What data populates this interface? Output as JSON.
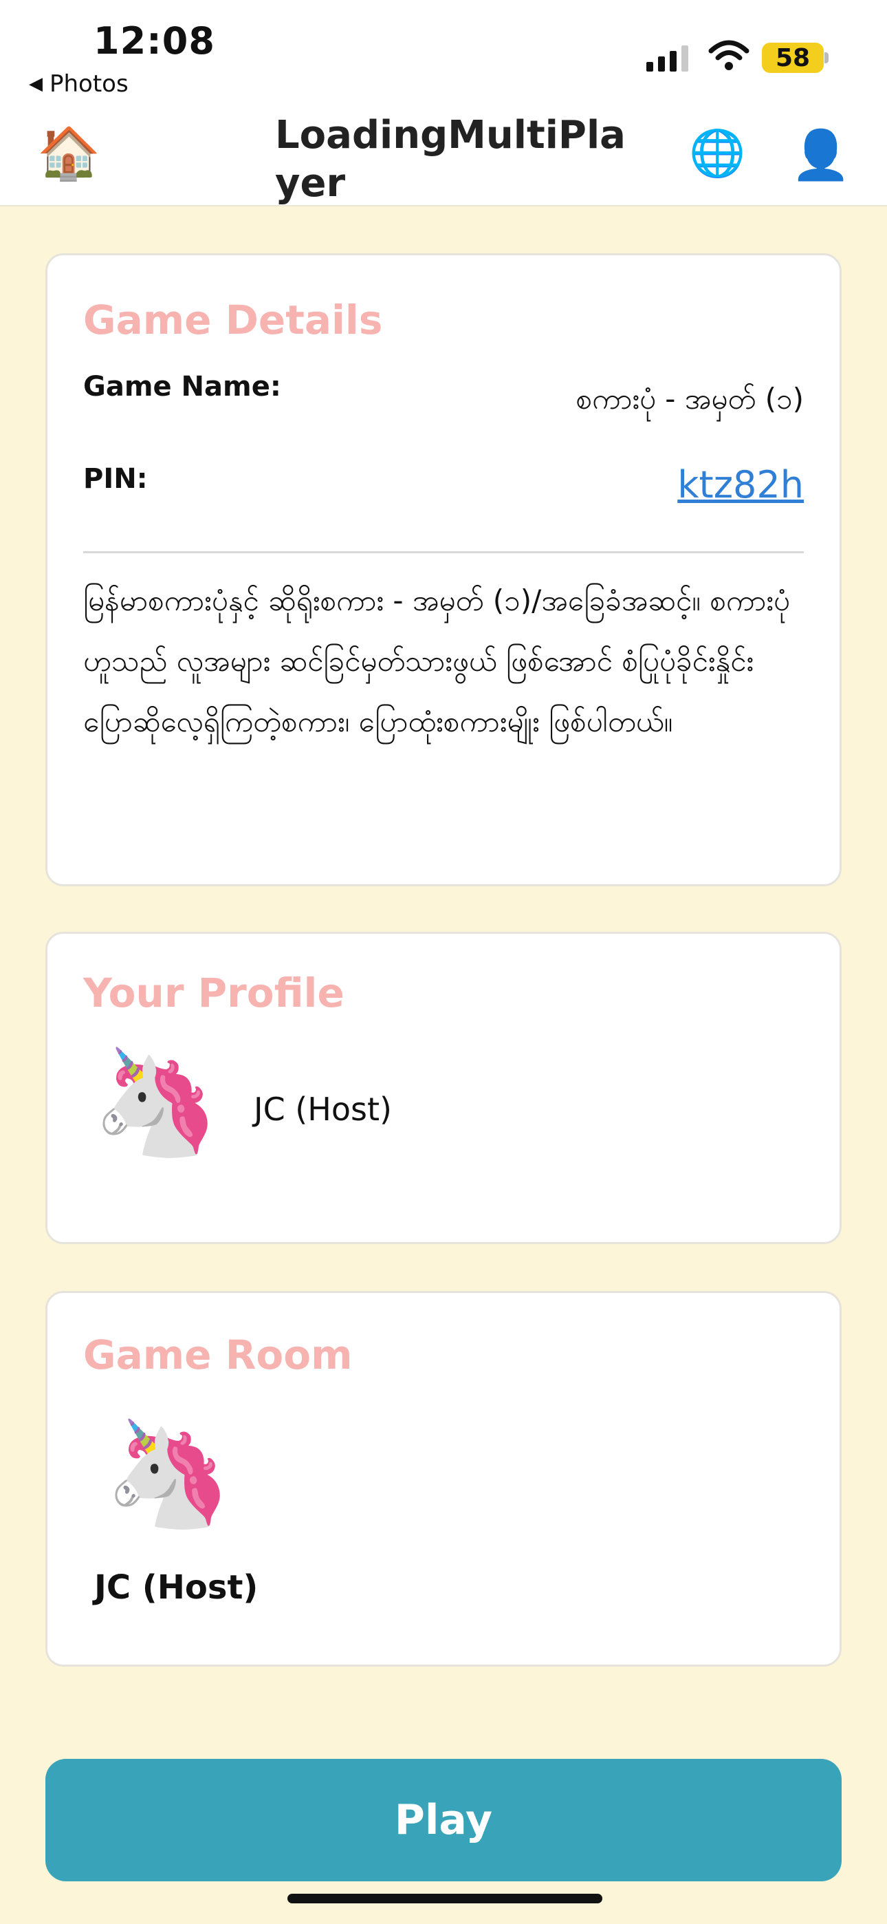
{
  "status_bar": {
    "time": "12:08",
    "back_app": "Photos",
    "back_icon": "triangle-left-icon",
    "battery": "58",
    "battery_color": "#f3ce1c"
  },
  "nav": {
    "title": "LoadingMultiPlayer",
    "home_icon": "🏠",
    "globe_icon": "🌐",
    "profile_icon": "👤"
  },
  "game_details": {
    "title": "Game Details",
    "name_label": "Game Name:",
    "name_value": "စကားပုံ - အမှတ် (၁)",
    "pin_label": "PIN:",
    "pin_value": "ktz82h",
    "description": "မြန်မာစကားပုံနှင့် ဆိုရိုးစကား - အမှတ် (၁)/အခြေခံအဆင့်။ စကားပုံဟူသည် လူအများ ဆင်ခြင်မှတ်သားဖွယ် ဖြစ်အောင် စံပြုပုံခိုင်းနှိုင်း ပြောဆိုလေ့ရှိကြတဲ့စကား၊ ပြောထုံးစကားမျိုး ဖြစ်ပါတယ်။"
  },
  "profile": {
    "title": "Your Profile",
    "avatar": "🦄",
    "name": "JC (Host)"
  },
  "room": {
    "title": "Game Room",
    "players": [
      {
        "avatar": "🦄",
        "name": "JC (Host)"
      }
    ]
  },
  "play_button": "Play",
  "colors": {
    "background": "#fdf5d8",
    "card_title": "#f7b3b0",
    "play_button": "#39a4b9",
    "link": "#2f7fd6"
  }
}
